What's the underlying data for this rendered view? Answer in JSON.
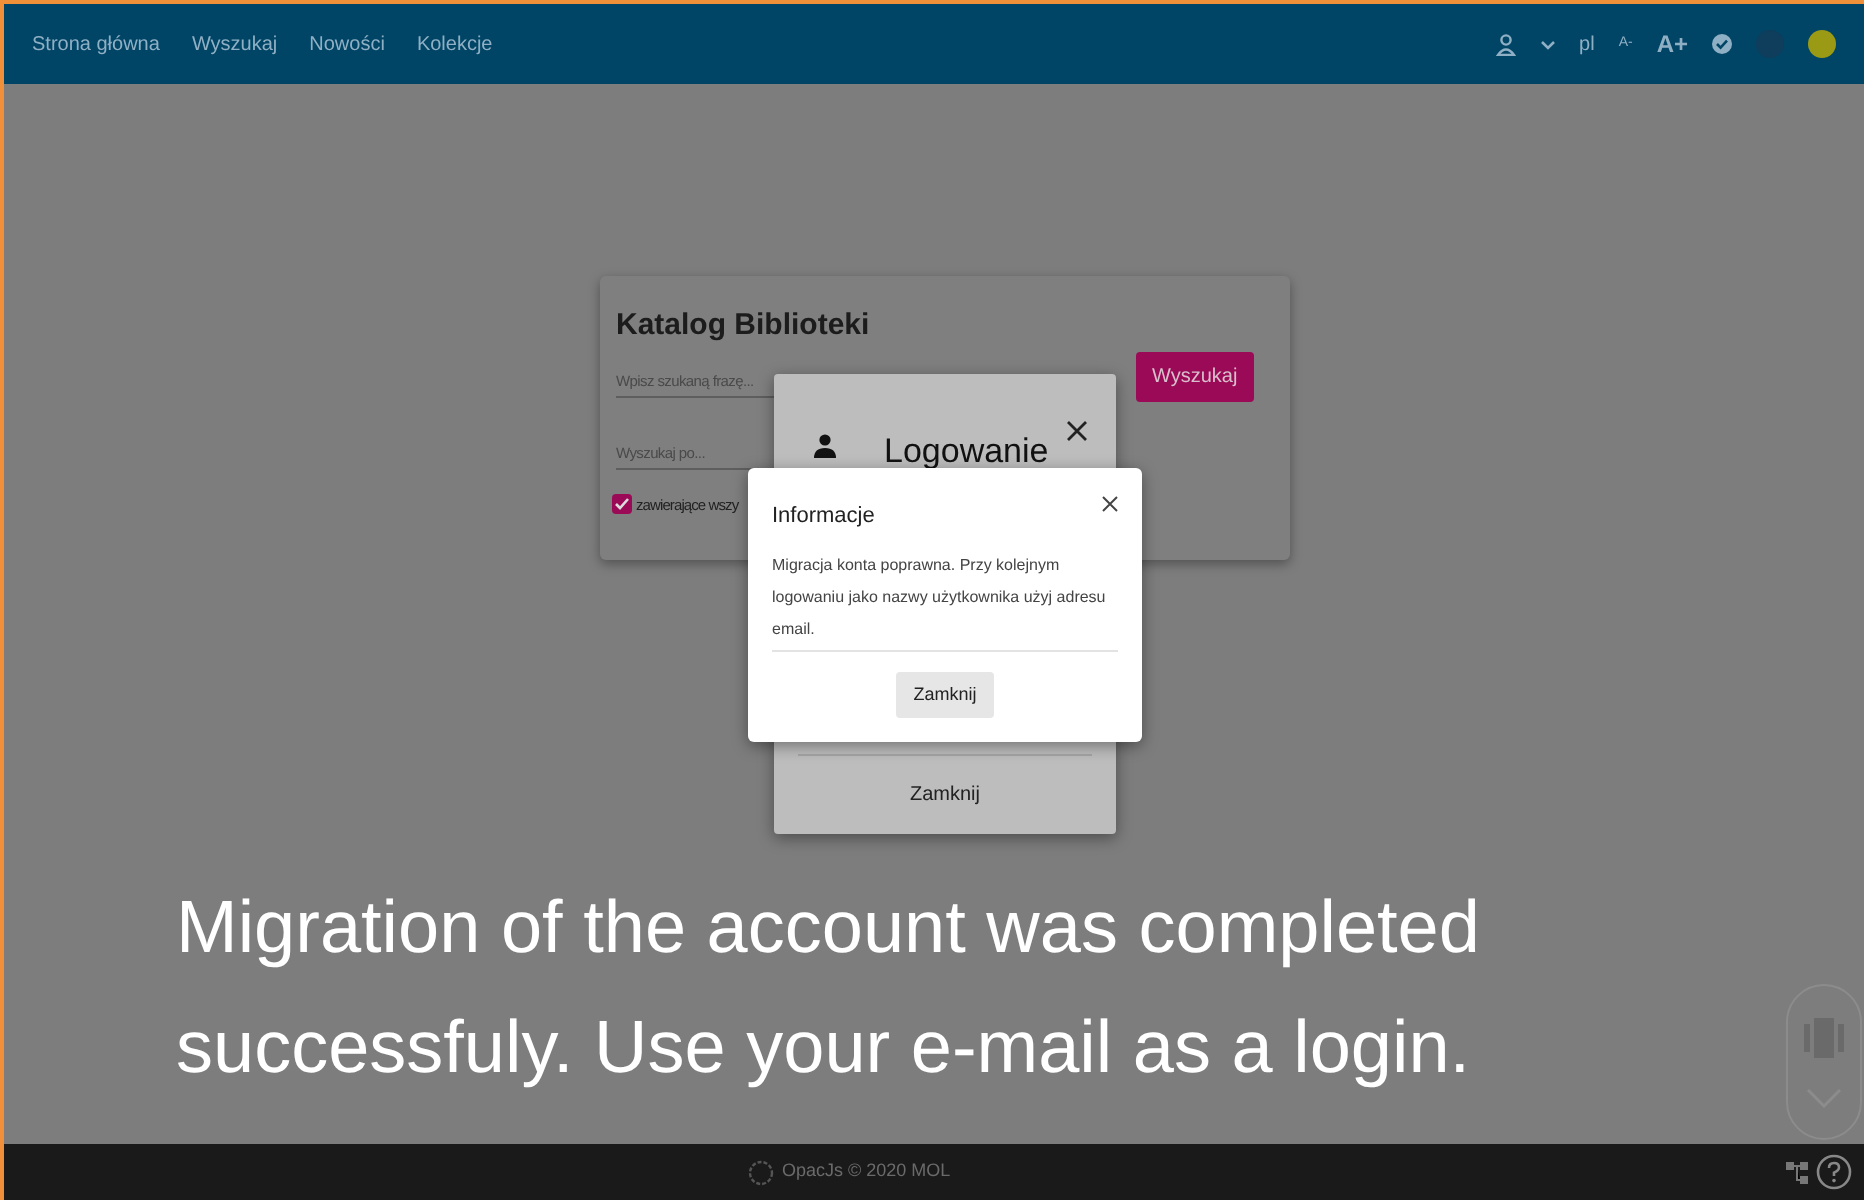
{
  "navbar": {
    "links": [
      {
        "label": "Strona główna"
      },
      {
        "label": "Wyszukaj"
      },
      {
        "label": "Nowości"
      },
      {
        "label": "Kolekcje"
      }
    ],
    "language": "pl",
    "font_smaller": "A-",
    "font_larger": "A+"
  },
  "search_card": {
    "title": "Katalog Biblioteki",
    "query_placeholder": "Wpisz szukaną frazę...",
    "field_placeholder": "Wyszukaj po...",
    "search_button": "Wyszukaj",
    "option": {
      "label": "zawierające wszy",
      "checked": true
    }
  },
  "login_dialog": {
    "title": "Logowanie",
    "close_button": "Zamknij"
  },
  "info_dialog": {
    "title": "Informacje",
    "message": "Migracja konta poprawna. Przy kolejnym logowaniu jako nazwy użytkownika użyj adresu email.",
    "close_button": "Zamknij"
  },
  "caption": "Migration of the account was completed successfuly. Use your e-mail as a login.",
  "footer": {
    "text": "OpacJs © 2020 MOL"
  }
}
